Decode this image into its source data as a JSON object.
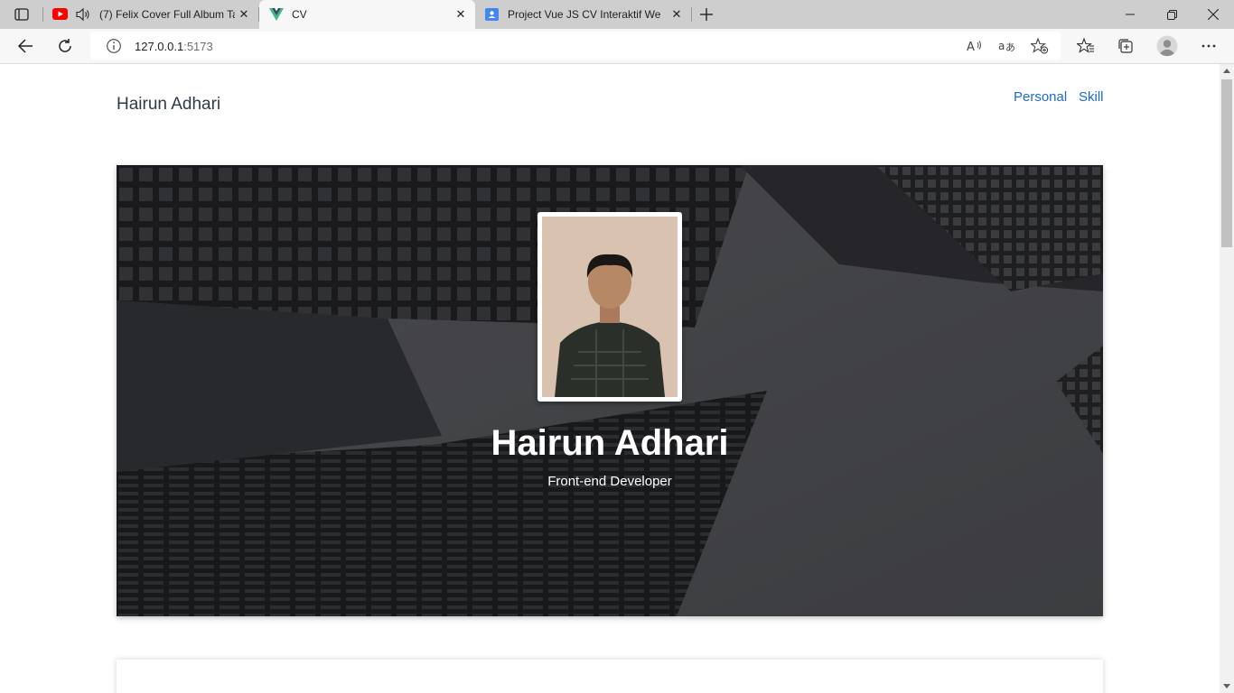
{
  "browser": {
    "tabs": [
      {
        "title": "(7) Felix Cover Full Album Ta",
        "favicon": "youtube-icon"
      },
      {
        "title": "CV",
        "favicon": "vue-icon"
      },
      {
        "title": "Project Vue JS CV Interaktif Web",
        "favicon": "classroom-icon"
      }
    ],
    "active_tab": 1,
    "url_host": "127.0.0.1",
    "url_port": ":5173"
  },
  "page": {
    "brand": "Hairun Adhari",
    "nav": [
      {
        "label": "Personal"
      },
      {
        "label": "Skill"
      }
    ],
    "hero": {
      "name": "Hairun Adhari",
      "role": "Front-end Developer"
    }
  },
  "colors": {
    "link": "#1c69d3",
    "brand_text": "#2f3a45",
    "hero_text": "#ffffff",
    "tabbar": "#cecece",
    "toolbar": "#f7f7f7"
  }
}
